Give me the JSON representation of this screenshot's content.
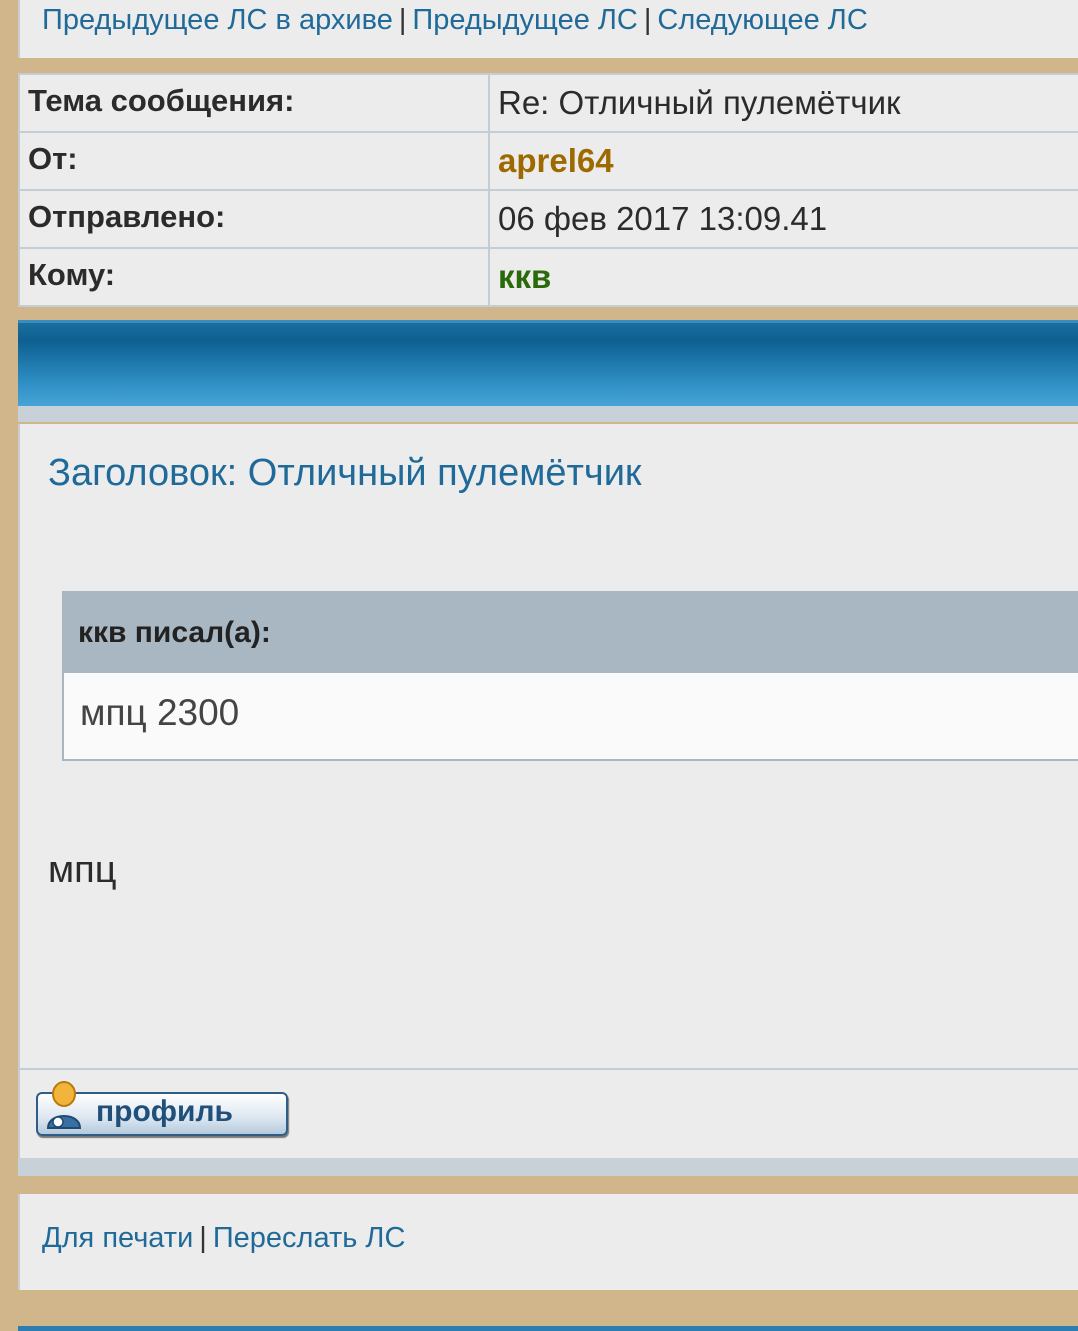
{
  "nav_top": {
    "prev_archive": "Предыдущее ЛС в архиве",
    "prev": "Предыдущее ЛС",
    "next": "Следующее ЛС",
    "sep": "|"
  },
  "header": {
    "subject_label": "Тема сообщения:",
    "subject_value": "Re: Отличный пулемётчик",
    "from_label": "От:",
    "from_value": "aprel64",
    "sent_label": "Отправлено:",
    "sent_value": "06 фев 2017 13:09.41",
    "to_label": "Кому:",
    "to_value": "ккв"
  },
  "message": {
    "title": "Заголовок: Отличный пулемётчик",
    "quote_author": "ккв писал(а):",
    "quote_text": "мпц 2300",
    "text": "мпц"
  },
  "profile_button": {
    "label": "профиль",
    "icon": "user-icon"
  },
  "nav_bottom": {
    "print": "Для печати",
    "forward": "Переслать ЛС",
    "sep": "|"
  },
  "colors": {
    "background": "#d1b68b",
    "link": "#1f6a99",
    "from_user": "#9e6a00",
    "to_user": "#2a6a0a",
    "blue_bar": "#0d5f90"
  }
}
